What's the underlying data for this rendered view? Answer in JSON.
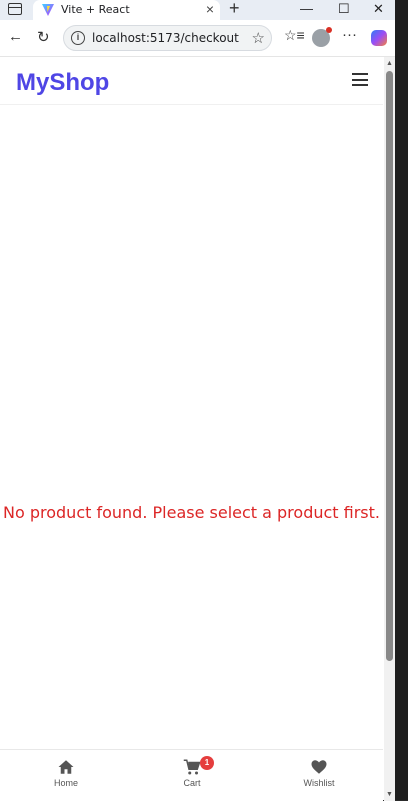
{
  "browser": {
    "tab_title": "Vite + React",
    "url": "localhost:5173/checkout"
  },
  "app": {
    "logo": "MyShop",
    "message": "No product found. Please select a product first.",
    "accent_color": "#4f46e5",
    "message_color": "#dc2626"
  },
  "bottom_nav": {
    "home_label": "Home",
    "cart_label": "Cart",
    "cart_count": "1",
    "wishlist_label": "Wishlist"
  },
  "icons": [
    "sidebar-toggle-icon",
    "vite-favicon-icon",
    "close-icon",
    "plus-icon",
    "minimize-icon",
    "maximize-icon",
    "back-icon",
    "reload-icon",
    "info-icon",
    "star-icon",
    "favorites-icon",
    "profile-icon",
    "more-icon",
    "copilot-icon",
    "hamburger-icon",
    "home-icon",
    "cart-icon",
    "heart-icon"
  ]
}
